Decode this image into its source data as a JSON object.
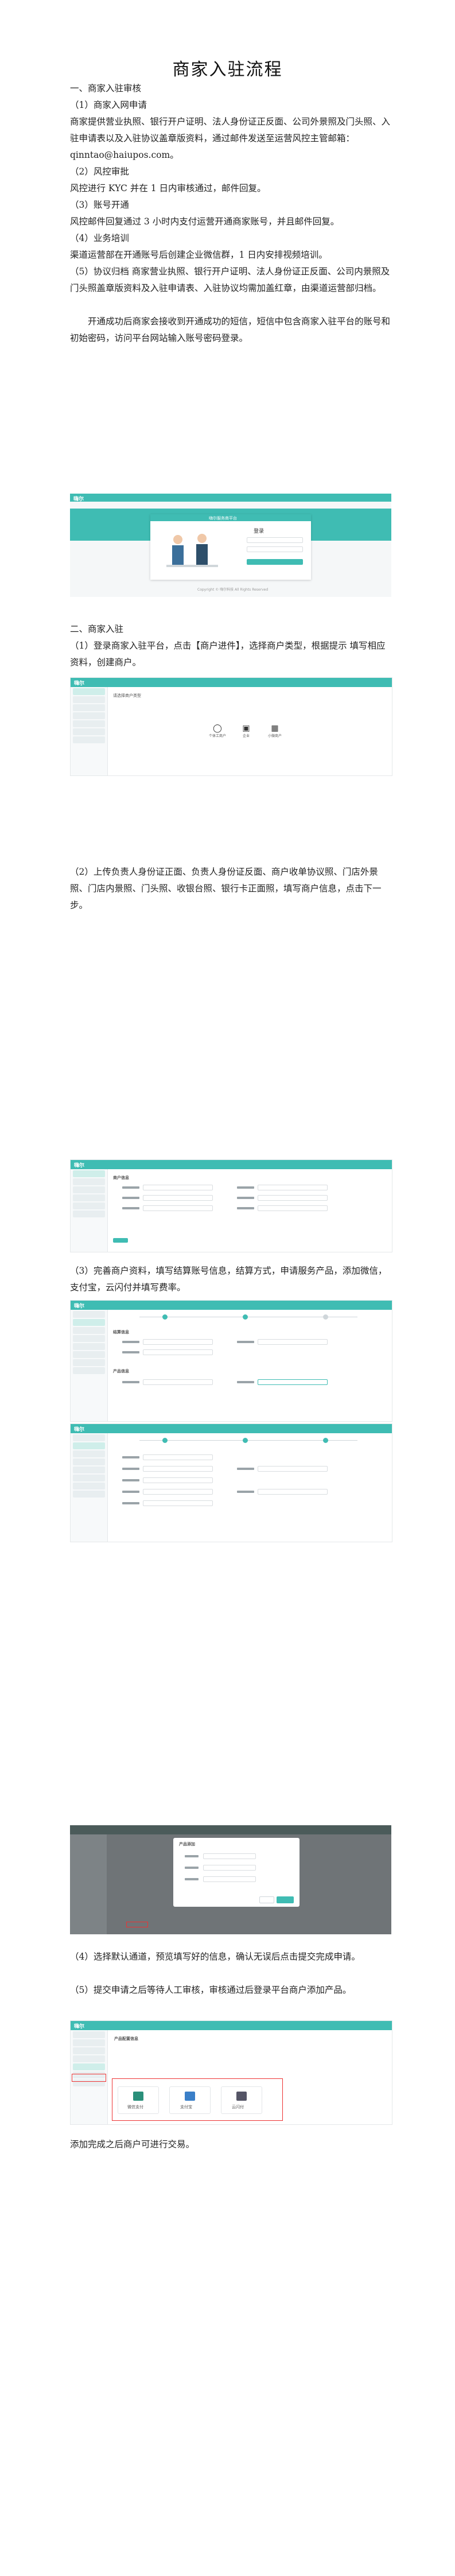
{
  "title": "商家入驻流程",
  "section1": {
    "heading": "一、商家入驻审核",
    "step1_title": "（1）商家入网申请",
    "step1_body": "商家提供营业执照、银行开户证明、法人身份证正反面、公司外景照及门头照、入驻申请表以及入驻协议盖章版资料，通过邮件发送至运营风控主管邮箱：qinntao@haiupos.com。",
    "step2_title": "（2）风控审批",
    "step2_body": "风控进行 KYC 并在 1 日内审核通过，邮件回复。",
    "step3_title": "（3）账号开通",
    "step3_body": "风控邮件回复通过 3 小时内支付运营开通商家账号，并且邮件回复。",
    "step4_title": "（4）业务培训",
    "step4_body": "渠道运营部在开通账号后创建企业微信群，1 日内安排视频培训。",
    "step5_body": "（5）协议归档 商家营业执照、银行开户证明、法人身份证正反面、公司内景照及门头照盖章版资料及入驻申请表、入驻协议均需加盖红章，由渠道运营部归档。",
    "step5_note": "开通成功后商家会接收到开通成功的短信，短信中包含商家入驻平台的账号和初始密码，访问平台网站输入账号密码登录。"
  },
  "section2": {
    "heading": "二、商家入驻",
    "step1_body": "（1）登录商家入驻平台，点击【商户进件】，选择商户类型，根据提示 填写相应资料，创建商户。",
    "step2_body": "（2）上传负责人身份证正面、负责人身份证反面、商户收单协议照、门店外景照、门店内景照、门头照、收银台照、银行卡正面照，填写商户信息，点击下一步。",
    "step3_body": "（3）完善商户资料，填写结算账号信息，结算方式，申请服务产品，添加微信，支付宝，云闪付并填写费率。",
    "step4_body": "（4）选择默认通道，预览填写好的信息，确认无误后点击提交完成申请。",
    "step5_body": "（5）提交申请之后等待人工审核，审核通过后登录平台商户添加产品。",
    "final_body": "添加完成之后商户可进行交易。"
  },
  "screens": {
    "logo": "嗨尔",
    "login_banner": "嗨尔服务商平台",
    "login_title": "登录",
    "login_footer": "Copyright © 嗨尔科技 All Rights Reserved",
    "merchant_prompt": "请选择商户类型",
    "type_personal": "个体工商户",
    "type_enterprise": "企业",
    "type_micro": "小微商户",
    "section_basic": "商户信息",
    "section_settle": "结算信息",
    "section_product": "产品信息",
    "dialog_title": "产品添加",
    "confirm": "确定",
    "product_title": "产品配置信息",
    "prod_a": "微信支付",
    "prod_b": "支付宝",
    "prod_c": "云闪付"
  }
}
